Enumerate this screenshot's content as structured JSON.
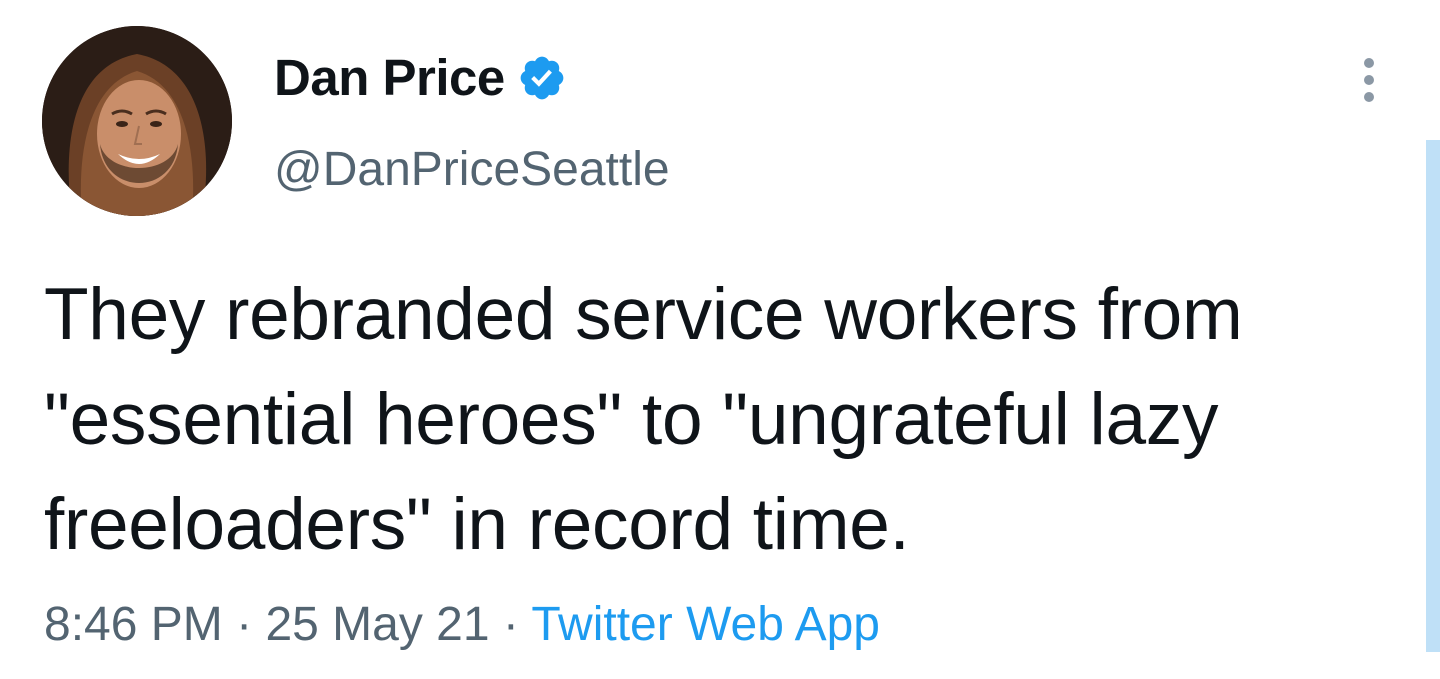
{
  "tweet": {
    "author": {
      "display_name": "Dan Price",
      "handle": "@DanPriceSeattle",
      "verified": true
    },
    "text": "They rebranded service workers from \"essential heroes\" to \"ungrateful lazy freeloaders\" in record time.",
    "meta": {
      "time": "8:46 PM",
      "separator": "·",
      "date": "25 May 21",
      "source": "Twitter Web App"
    }
  },
  "icons": {
    "verified": "verified-badge-icon",
    "more": "more-options-icon"
  },
  "colors": {
    "text": "#0f1419",
    "secondary_text": "#536471",
    "accent": "#1d9bf0",
    "scrollbar": "#bfe0f7"
  }
}
